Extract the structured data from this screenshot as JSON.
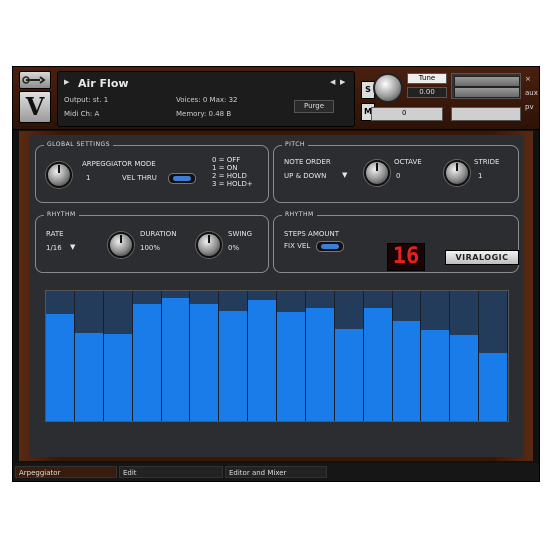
{
  "header": {
    "instrument_name": "Air Flow",
    "output_label": "Output: st. 1",
    "midi_label": "Midi Ch: A",
    "voices_label": "Voices: 0 Max: 32",
    "memory_label": "Memory: 0.48 B",
    "purge_label": "Purge",
    "s_button": "S",
    "m_button": "M",
    "tune_label": "Tune",
    "tune_value": "0.00",
    "pan_value": "0",
    "aux_label": "aux",
    "pv_label": "pv"
  },
  "global_settings": {
    "title": "GLOBAL SETTINGS",
    "mode_label": "ARPEGGIATOR MODE",
    "mode_value": "1",
    "velocity_label": "VEL THRU",
    "options": [
      "0 = OFF",
      "1 = ON",
      "2 = HOLD",
      "3 = HOLD+"
    ]
  },
  "pitch": {
    "title": "PITCH",
    "note_order_label": "NOTE ORDER",
    "note_order_value": "UP & DOWN",
    "octave_label": "OCTAVE",
    "octave_value": "0",
    "stride_label": "STRIDE",
    "stride_value": "1"
  },
  "rhythm_left": {
    "title": "RHYTHM",
    "rate_label": "RATE",
    "rate_value": "1/16",
    "duration_label": "DURATION",
    "duration_value": "100%",
    "swing_label": "SWING",
    "swing_value": "0%"
  },
  "rhythm_right": {
    "title": "RHYTHM",
    "steps_label": "STEPS AMOUNT",
    "fix_vel_label": "FIX VEL",
    "steps_value": "16",
    "brand": "VIRALOGIC"
  },
  "step_levels": [
    0.82,
    0.68,
    0.67,
    0.9,
    0.95,
    0.9,
    0.85,
    0.93,
    0.84,
    0.87,
    0.71,
    0.87,
    0.77,
    0.7,
    0.66,
    0.52
  ],
  "footer": {
    "tabs": [
      "Arpeggiator",
      "Edit",
      "Editor and Mixer"
    ]
  },
  "colors": {
    "bar_fill": "#1a7ce8",
    "bar_bg": "#233c5c",
    "led": "#e3241a",
    "wood": "#3a1608"
  }
}
